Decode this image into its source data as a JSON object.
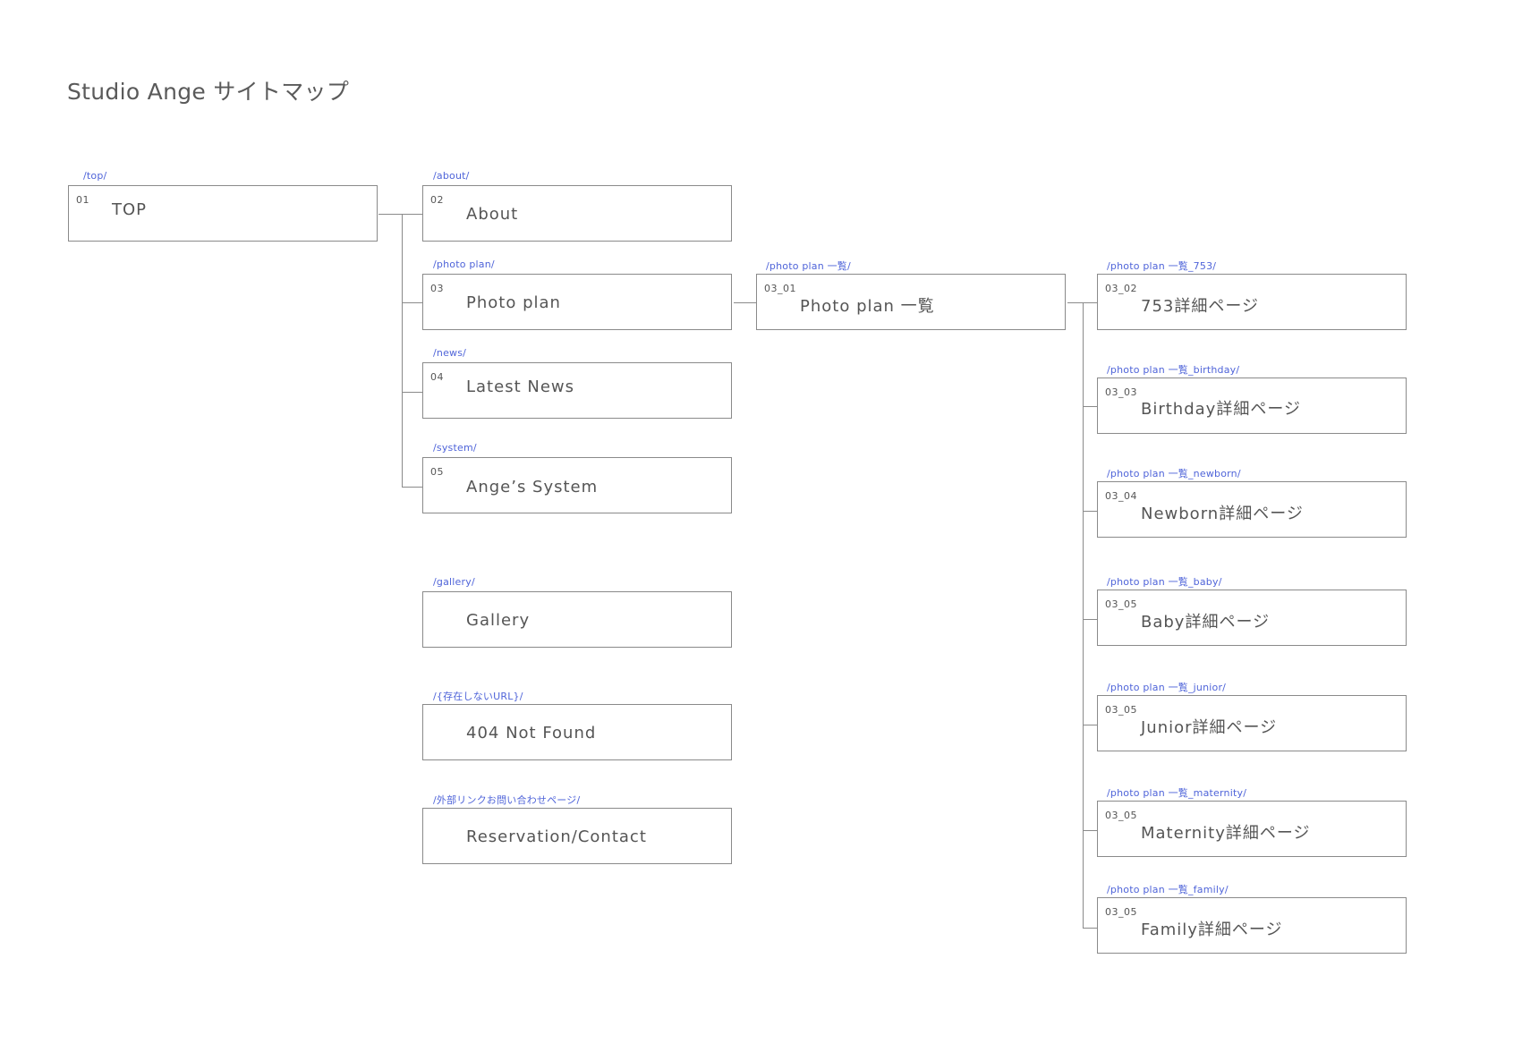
{
  "title": "Studio Ange サイトマップ",
  "pages": {
    "top": {
      "url": "/top/",
      "num": "01",
      "label": "TOP"
    },
    "about": {
      "url": "/about/",
      "num": "02",
      "label": "About"
    },
    "photoplan": {
      "url": "/photo plan/",
      "num": "03",
      "label": "Photo plan"
    },
    "news": {
      "url": "/news/",
      "num": "04",
      "label": "Latest News"
    },
    "system": {
      "url": "/system/",
      "num": "05",
      "label": "Ange’s System"
    },
    "gallery": {
      "url": "/gallery/",
      "num": "",
      "label": "Gallery"
    },
    "notfound": {
      "url": "/{存在しないURL}/",
      "num": "",
      "label": "404 Not Found"
    },
    "reserve": {
      "url": "/外部リンクお問い合わせページ/",
      "num": "",
      "label": "Reservation/Contact"
    },
    "list": {
      "url": "/photo plan 一覧/",
      "num": "03_01",
      "label": "Photo plan 一覧"
    },
    "p753": {
      "url": "/photo plan 一覧_753/",
      "num": "03_02",
      "label": "753詳細ページ"
    },
    "birthday": {
      "url": "/photo plan 一覧_birthday/",
      "num": "03_03",
      "label": "Birthday詳細ページ"
    },
    "newborn": {
      "url": "/photo plan 一覧_newborn/",
      "num": "03_04",
      "label": "Newborn詳細ページ"
    },
    "baby": {
      "url": "/photo plan 一覧_baby/",
      "num": "03_05",
      "label": "Baby詳細ページ"
    },
    "junior": {
      "url": "/photo plan 一覧_junior/",
      "num": "03_05",
      "label": "Junior詳細ページ"
    },
    "maternity": {
      "url": "/photo plan 一覧_maternity/",
      "num": "03_05",
      "label": "Maternity詳細ページ"
    },
    "family": {
      "url": "/photo plan 一覧_family/",
      "num": "03_05",
      "label": "Family詳細ページ"
    }
  },
  "colors": {
    "url_text": "#4f64d9",
    "border": "#8a8a8a",
    "text": "#555555"
  }
}
